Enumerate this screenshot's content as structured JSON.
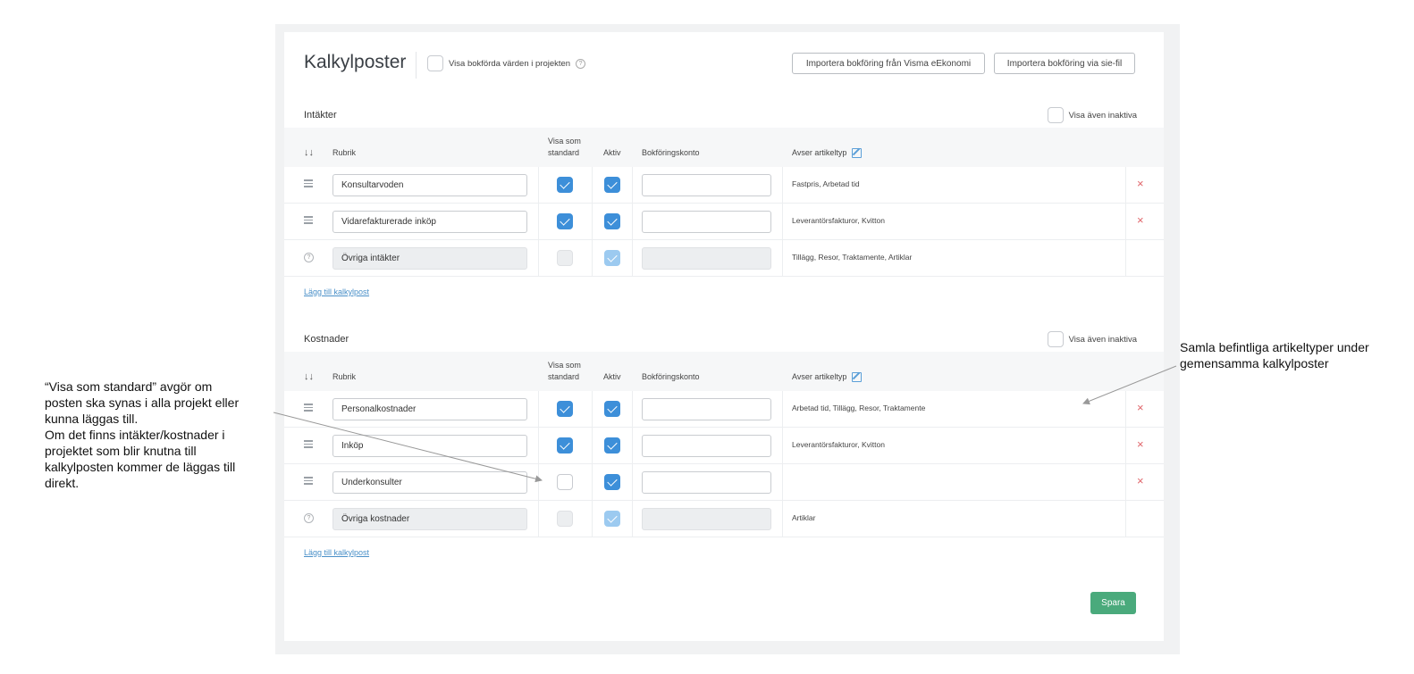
{
  "title": "Kalkylposter",
  "show_booked_label": "Visa bokförda värden i projekten",
  "help_glyph": "?",
  "buttons": {
    "import_visma": "Importera bokföring från Visma eEkonomi",
    "import_sie": "Importera bokföring via sie-fil",
    "save": "Spara"
  },
  "table_headers": {
    "sort": "↓↓",
    "rubrik": "Rubrik",
    "visa_som_line1": "Visa som",
    "visa_som_line2": "standard",
    "aktiv": "Aktiv",
    "konto": "Bokföringskonto",
    "avser": "Avser artikeltyp"
  },
  "income": {
    "title": "Intäkter",
    "show_inactive": "Visa även inaktiva",
    "add_link": "Lägg till kalkylpost",
    "rows": [
      {
        "name": "Konsultarvoden",
        "types": "Fastpris, Arbetad tid",
        "standard": true,
        "active": true,
        "editable": true
      },
      {
        "name": "Vidarefakturerade inköp",
        "types": "Leverantörsfakturor, Kvitton",
        "standard": true,
        "active": true,
        "editable": true
      },
      {
        "name": "Övriga intäkter",
        "types": "Tillägg, Resor, Traktamente, Artiklar",
        "standard": false,
        "active": true,
        "editable": false
      }
    ]
  },
  "costs": {
    "title": "Kostnader",
    "show_inactive": "Visa även inaktiva",
    "add_link": "Lägg till kalkylpost",
    "rows": [
      {
        "name": "Personalkostnader",
        "types": "Arbetad tid, Tillägg, Resor, Traktamente",
        "standard": true,
        "active": true,
        "editable": true
      },
      {
        "name": "Inköp",
        "types": "Leverantörsfakturor, Kvitton",
        "standard": true,
        "active": true,
        "editable": true
      },
      {
        "name": "Underkonsulter",
        "types": "",
        "standard": false,
        "active": true,
        "editable": true
      },
      {
        "name": "Övriga kostnader",
        "types": "Artiklar",
        "standard": false,
        "active": true,
        "editable": false
      }
    ]
  },
  "delete_glyph": "×",
  "annotations": {
    "left": [
      "“Visa som standard” avgör om",
      "posten ska synas i alla projekt eller",
      "kunna läggas till.",
      "Om det finns intäkter/kostnader i",
      "projektet som blir knutna till",
      "kalkylposten kommer de läggas till",
      "direkt."
    ],
    "right": [
      "Samla befintliga artikeltyper under",
      "gemensamma kalkylposter"
    ]
  },
  "colors": {
    "accent": "#3d8fd9",
    "save": "#4aaa7c",
    "delete": "#e0656a",
    "link": "#4a90c8"
  }
}
